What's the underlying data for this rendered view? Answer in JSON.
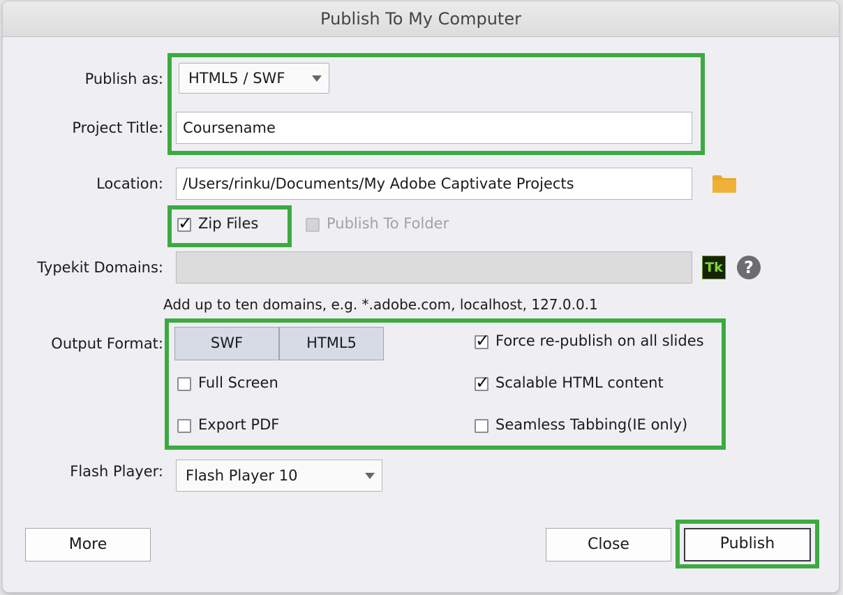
{
  "window": {
    "title": "Publish To My Computer"
  },
  "publish_as": {
    "label": "Publish as:",
    "value": "HTML5 / SWF"
  },
  "project_title": {
    "label": "Project Title:",
    "value": "Coursename"
  },
  "location": {
    "label": "Location:",
    "value": "/Users/rinku/Documents/My Adobe Captivate Projects",
    "icon": "folder-icon"
  },
  "zip_files": {
    "label": "Zip Files",
    "checked": true
  },
  "publish_to_folder": {
    "label": "Publish To Folder",
    "checked": false,
    "disabled": true
  },
  "typekit": {
    "label": "Typekit Domains:",
    "value": "",
    "tk_text": "Tk",
    "help_text": "?",
    "hint": "Add up to ten domains, e.g. *.adobe.com, localhost, 127.0.0.1"
  },
  "output_format": {
    "label": "Output Format:",
    "segments": [
      "SWF",
      "HTML5"
    ],
    "options": {
      "full_screen": {
        "label": "Full Screen",
        "checked": false
      },
      "export_pdf": {
        "label": "Export PDF",
        "checked": false
      },
      "force_republish": {
        "label": "Force re-publish on all slides",
        "checked": true
      },
      "scalable_html": {
        "label": "Scalable HTML content",
        "checked": true
      },
      "seamless_tabbing": {
        "label": "Seamless Tabbing(IE only)",
        "checked": false
      }
    }
  },
  "flash_player": {
    "label": "Flash Player:",
    "value": "Flash Player 10"
  },
  "buttons": {
    "more": "More",
    "close": "Close",
    "publish": "Publish"
  },
  "colors": {
    "highlight": "#3daa41",
    "folder": "#e8a92a",
    "tk_bg": "#162409",
    "tk_fg": "#7bd92f"
  }
}
